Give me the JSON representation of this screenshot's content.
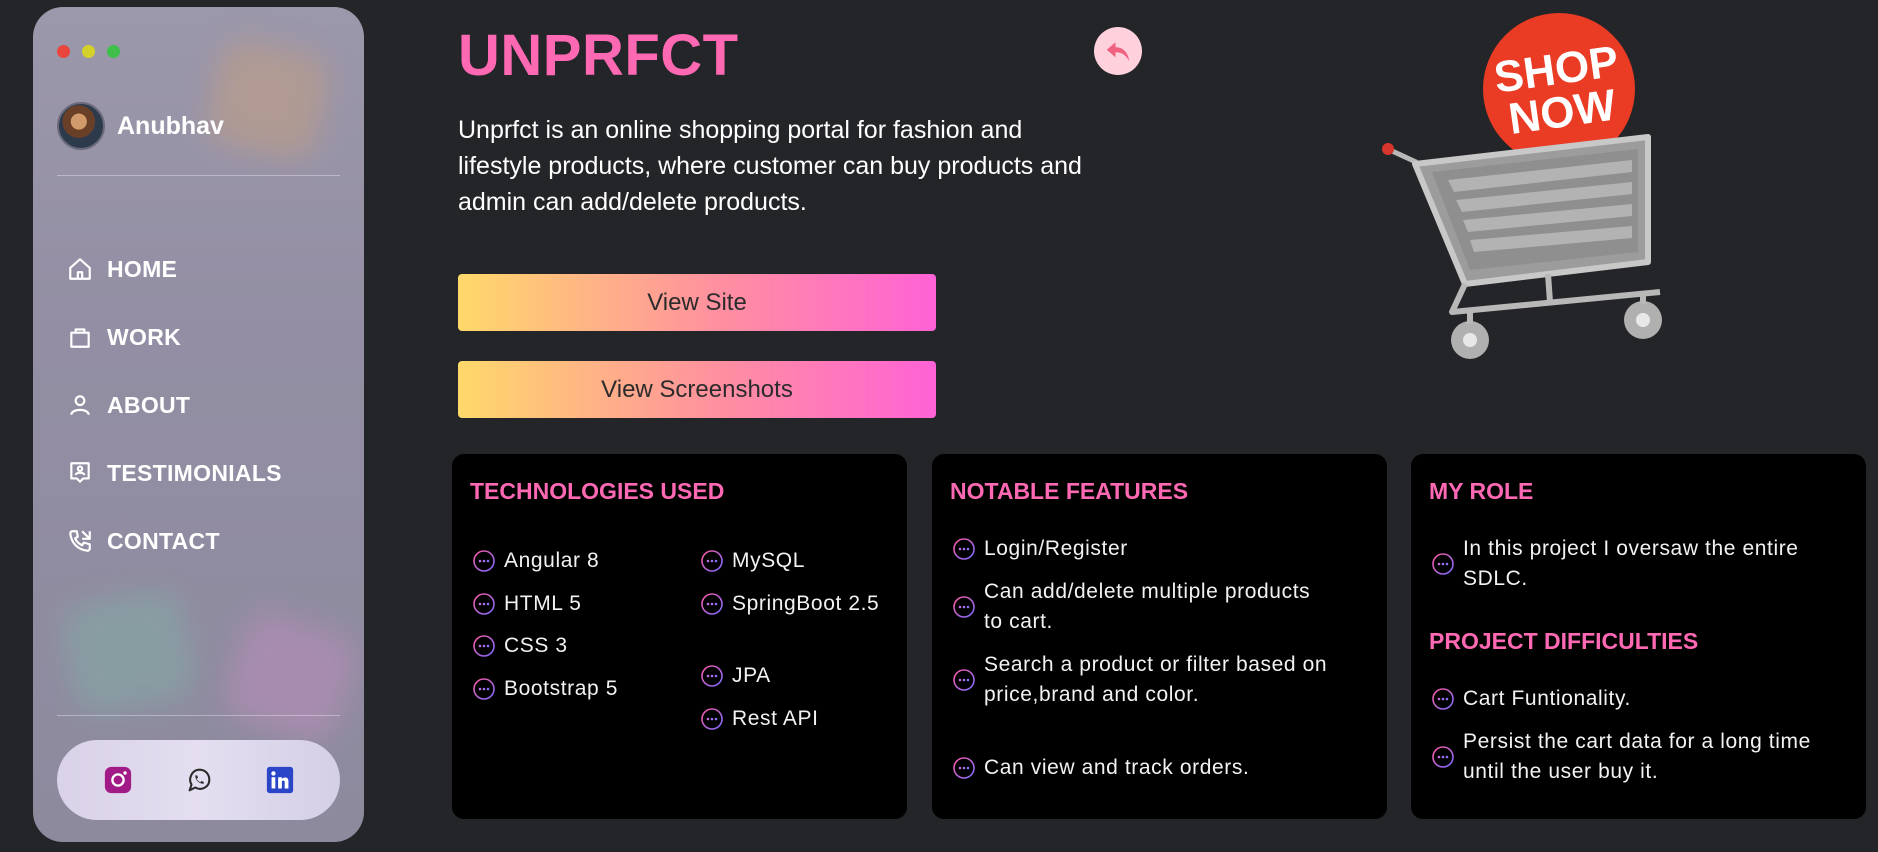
{
  "sidebar": {
    "user_name": "Anubhav",
    "nav": [
      {
        "label": "HOME",
        "icon": "home-icon"
      },
      {
        "label": "WORK",
        "icon": "briefcase-icon"
      },
      {
        "label": "ABOUT",
        "icon": "user-icon"
      },
      {
        "label": "TESTIMONIALS",
        "icon": "testimonial-icon"
      },
      {
        "label": "CONTACT",
        "icon": "phone-icon"
      }
    ],
    "social": [
      "instagram-icon",
      "whatsapp-icon",
      "linkedin-icon"
    ]
  },
  "project": {
    "title": "UNPRFCT",
    "description": "Unprfct is an online shopping portal for fashion and lifestyle products, where customer can buy products and admin can add/delete products.",
    "buttons": {
      "view_site": "View Site",
      "view_screenshots": "View Screenshots"
    },
    "hero_badge_line1": "SHOP",
    "hero_badge_line2": "NOW"
  },
  "cards": {
    "technologies": {
      "heading": "TECHNOLOGIES USED",
      "left": [
        "Angular 8",
        "HTML 5",
        "CSS 3",
        "Bootstrap 5"
      ],
      "right": [
        "MySQL",
        "SpringBoot 2.5",
        "JPA",
        "Rest API"
      ]
    },
    "features": {
      "heading": "NOTABLE FEATURES",
      "items": [
        "Login/Register",
        "Can add/delete multiple products to cart.",
        "Search a product or filter based on price,brand and color.",
        "Can view and track orders."
      ]
    },
    "role": {
      "heading": "MY ROLE",
      "items": [
        "In this project I oversaw the entire SDLC."
      ],
      "difficulties_heading": "PROJECT DIFFICULTIES",
      "difficulties": [
        "Cart Funtionality.",
        "Persist the cart data for a long time until the user buy it."
      ]
    }
  },
  "colors": {
    "accent": "#ff69b4",
    "background": "#242528",
    "card": "#000000",
    "dot_red": "#e8453c",
    "dot_yellow": "#d4d12a",
    "dot_green": "#3fc04a"
  }
}
